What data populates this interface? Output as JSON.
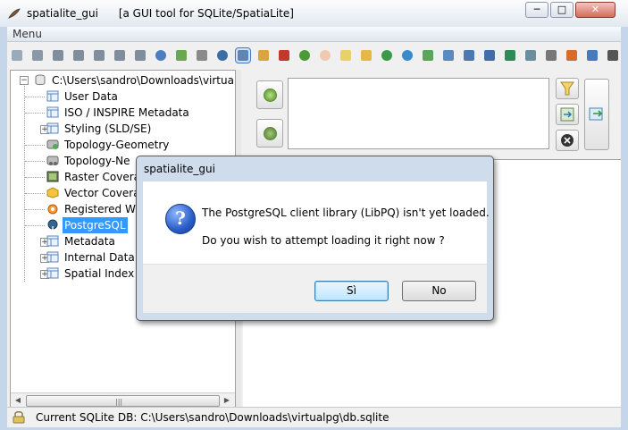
{
  "window": {
    "title": "spatialite_gui",
    "subtitle": "[a GUI tool for SQLite/SpatiaLite]",
    "controls": {
      "minimize": "─",
      "maximize": "□",
      "close": "✕"
    }
  },
  "menu": {
    "items": [
      {
        "label": "Menu"
      }
    ]
  },
  "tree": {
    "root_label": "C:\\Users\\sandro\\Downloads\\virtualpg",
    "items": [
      {
        "label": "User Data"
      },
      {
        "label": "ISO / INSPIRE Metadata"
      },
      {
        "label": "Styling (SLD/SE)"
      },
      {
        "label": "Topology-Geometry"
      },
      {
        "label": "Topology-Ne"
      },
      {
        "label": "Raster Covera"
      },
      {
        "label": "Vector Covera"
      },
      {
        "label": "Registered WI"
      },
      {
        "label": "PostgreSQL"
      },
      {
        "label": "Metadata"
      },
      {
        "label": "Internal Data"
      },
      {
        "label": "Spatial Index"
      }
    ],
    "selected": "PostgreSQL",
    "scroll_grip": "|||"
  },
  "status": {
    "text": "Current SQLite DB: C:\\Users\\sandro\\Downloads\\virtualpg\\db.sqlite"
  },
  "dialog": {
    "title": "spatialite_gui",
    "icon": "question-icon",
    "line1": "The PostgreSQL client library (LibPQ) isn't yet loaded.",
    "line2": "Do you wish to attempt loading it right now ?",
    "yes_label": "Sì",
    "no_label": "No"
  },
  "colors": {
    "selection": "#3399ff",
    "dialog_frame": "#cfdcec",
    "default_button": "#bee6fd"
  }
}
